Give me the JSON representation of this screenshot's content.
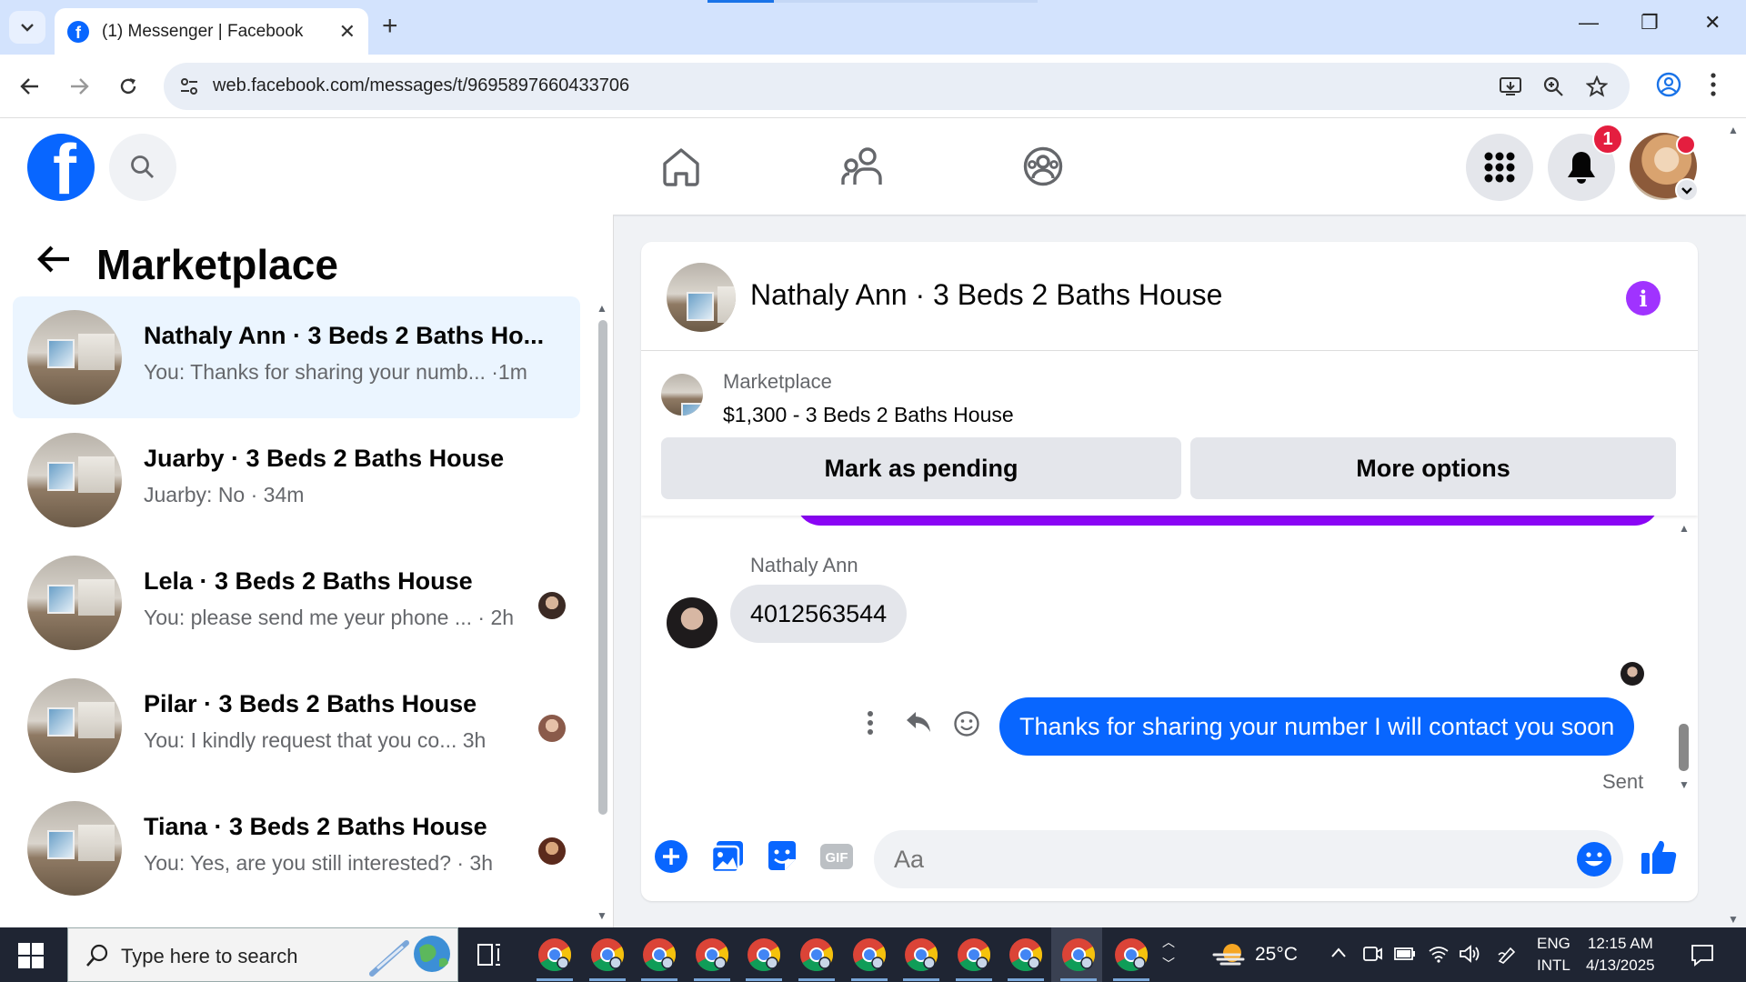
{
  "browser": {
    "tab_title": "(1) Messenger | Facebook",
    "url": "web.facebook.com/messages/t/9695897660433706",
    "window_controls": {
      "minimize": "—",
      "restore": "❐",
      "close": "✕"
    },
    "new_tab": "+"
  },
  "header": {
    "notification_count": "1",
    "brand_color": "#0866ff"
  },
  "sidebar": {
    "title": "Marketplace",
    "conversations": [
      {
        "name": "Nathaly Ann · 3 Beds 2 Baths Ho...",
        "snippet": "You: Thanks for sharing your numb... ·1m",
        "active": true
      },
      {
        "name": "Juarby · 3 Beds 2 Baths House",
        "snippet": "Juarby: No · 34m",
        "active": false
      },
      {
        "name": "Lela · 3 Beds 2 Baths House",
        "snippet": "You: please send me yeur phone ... · 2h",
        "active": false
      },
      {
        "name": "Pilar · 3 Beds 2 Baths House",
        "snippet": "You: I kindly request that you co...   3h",
        "active": false
      },
      {
        "name": "Tiana · 3 Beds 2 Baths House",
        "snippet": "You: Yes, are you still interested? · 3h",
        "active": false
      }
    ]
  },
  "chat": {
    "title": "Nathaly Ann · 3 Beds 2 Baths House",
    "listing": {
      "label": "Marketplace",
      "price_title": "$1,300 - 3 Beds 2 Baths House",
      "mark_pending": "Mark as pending",
      "more_options": "More options"
    },
    "messages": [
      {
        "sender": "Nathaly Ann",
        "text": "4012563544",
        "direction": "incoming"
      },
      {
        "sender": "You",
        "text": "Thanks for sharing your number I will contact you soon",
        "direction": "outgoing",
        "status": "Sent"
      }
    ],
    "composer_placeholder": "Aa",
    "outgoing_color": "#0866ff",
    "accent_color": "#a033ff"
  },
  "taskbar": {
    "search_placeholder": "Type here to search",
    "weather": "25°C",
    "lang_line1": "ENG",
    "lang_line2": "INTL",
    "time": "12:15 AM",
    "date": "4/13/2025",
    "pinned_chrome_count": 12
  }
}
